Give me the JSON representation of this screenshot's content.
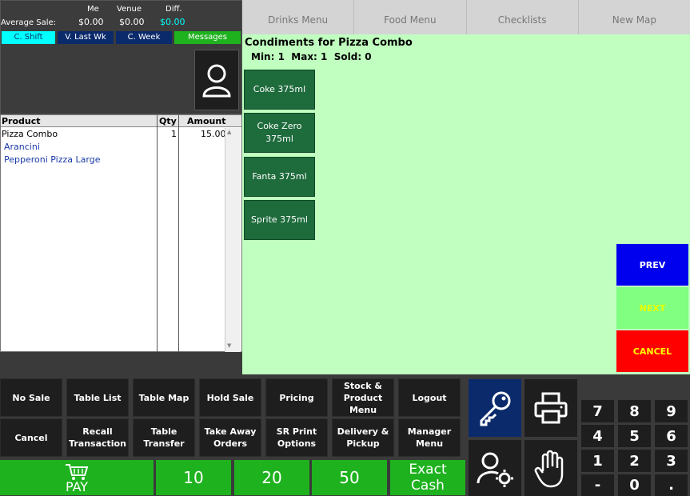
{
  "stats": {
    "row_label": "Average Sale:",
    "columns": [
      {
        "head": "Me",
        "value": "$0.00"
      },
      {
        "head": "Venue",
        "value": "$0.00"
      },
      {
        "head": "Diff.",
        "value": "$0.00"
      }
    ],
    "periods": [
      {
        "label": "C. Shift",
        "color": "#00ffff",
        "text_color": "#003366"
      },
      {
        "label": "V. Last Wk",
        "color": "#0b2a6b",
        "text_color": "#ffffff"
      },
      {
        "label": "C. Week",
        "color": "#0b2a6b",
        "text_color": "#ffffff"
      },
      {
        "label": "Messages",
        "color": "#1fb21f",
        "text_color": "#ffffff"
      }
    ]
  },
  "order": {
    "headers": {
      "product": "Product",
      "qty": "Qty",
      "amount": "Amount"
    },
    "main_item": {
      "product": "Pizza Combo",
      "qty": "1",
      "amount": "15.00"
    },
    "sub_items": [
      "Arancini",
      "Pepperoni Pizza Large"
    ]
  },
  "tabs": [
    "Drinks Menu",
    "Food Menu",
    "Checklists",
    "New Map"
  ],
  "condiments": {
    "title": "Condiments for Pizza Combo",
    "limits": "Min: 1  Max: 1  Sold: 0",
    "items": [
      {
        "line1": "Coke 375ml",
        "line2": ""
      },
      {
        "line1": "Coke Zero",
        "line2": "375ml"
      },
      {
        "line1": "Fanta 375ml",
        "line2": ""
      },
      {
        "line1": "Sprite 375ml",
        "line2": ""
      }
    ],
    "prev": "PREV",
    "next": "NEXT",
    "cancel": "CANCEL"
  },
  "functions": {
    "row1": [
      [
        "No Sale",
        ""
      ],
      [
        "Table List",
        ""
      ],
      [
        "Table Map",
        ""
      ],
      [
        "Hold Sale",
        ""
      ],
      [
        "Pricing",
        ""
      ],
      [
        "Stock &",
        "Product",
        "Menu"
      ],
      [
        "Logout",
        ""
      ]
    ],
    "row2": [
      [
        "Cancel",
        ""
      ],
      [
        "Recall",
        "Transaction"
      ],
      [
        "Table",
        "Transfer"
      ],
      [
        "Take Away",
        "Orders"
      ],
      [
        "SR Print",
        "Options"
      ],
      [
        "Delivery &",
        "Pickup"
      ],
      [
        "Manager",
        "Menu"
      ]
    ]
  },
  "payment": {
    "pay": "PAY",
    "amounts": [
      "10",
      "20",
      "50"
    ],
    "exact1": "Exact",
    "exact2": "Cash"
  },
  "keypad": {
    "row1": [
      "7",
      "8",
      "9"
    ],
    "row2": [
      "4",
      "5",
      "6"
    ],
    "row3": [
      "1",
      "2",
      "3"
    ],
    "row4": [
      "-",
      "0",
      "."
    ]
  },
  "icons": [
    "key-icon",
    "printer-icon",
    "user-settings-icon",
    "hand-icon",
    "user-icon",
    "cart-icon"
  ]
}
